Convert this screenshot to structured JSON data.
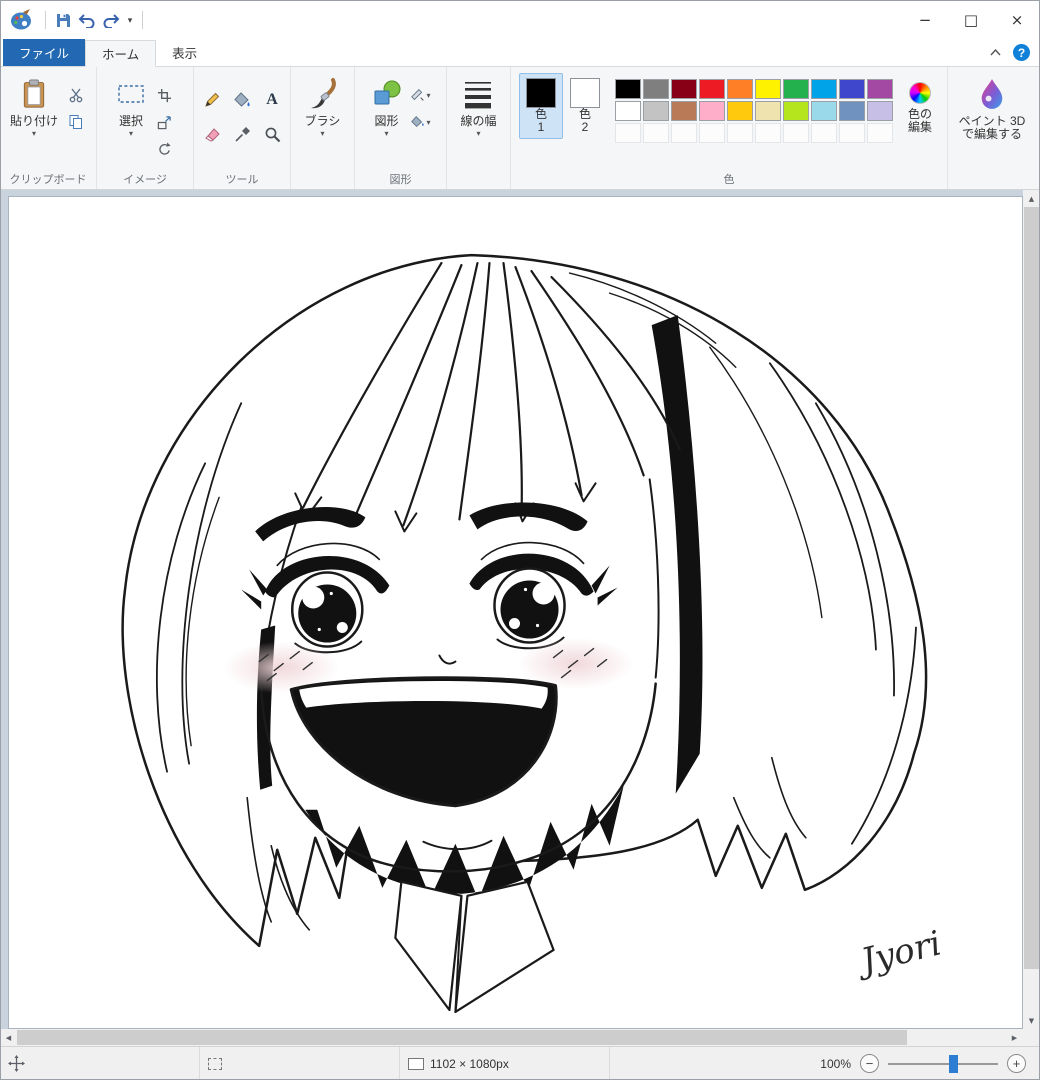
{
  "titlebar": {
    "window_controls": {
      "minimize": "−",
      "maximize": "□",
      "close": "×"
    }
  },
  "icons": {
    "dropdown": "▾",
    "help": "?",
    "text_tool": "A",
    "zoom_out": "−",
    "zoom_in": "+",
    "scroll_up": "▲",
    "scroll_down": "▼",
    "scroll_left": "◀",
    "scroll_right": "▶"
  },
  "tabs": {
    "file": "ファイル",
    "home": "ホーム",
    "view": "表示"
  },
  "ribbon": {
    "clipboard": {
      "group_label": "クリップボード",
      "paste": "貼り付け"
    },
    "image": {
      "group_label": "イメージ",
      "select": "選択"
    },
    "tools": {
      "group_label": "ツール"
    },
    "brush": {
      "label": "ブラシ"
    },
    "shapes": {
      "group_label": "図形",
      "button": "図形"
    },
    "size": {
      "label": "線の幅"
    },
    "colors": {
      "group_label": "色",
      "color1": {
        "line1": "色",
        "line2": "1",
        "value": "#000000"
      },
      "color2": {
        "line1": "色",
        "line2": "2",
        "value": "#ffffff"
      },
      "edit": {
        "line1": "色の",
        "line2": "編集"
      },
      "palette_row1": [
        "#000000",
        "#7f7f7f",
        "#880015",
        "#ed1c24",
        "#ff7f27",
        "#fff200",
        "#22b14c",
        "#00a2e8",
        "#3f48cc",
        "#a349a4"
      ],
      "palette_row2": [
        "#ffffff",
        "#c3c3c3",
        "#b97a57",
        "#ffaec9",
        "#ffc90e",
        "#efe4b0",
        "#b5e61d",
        "#99d9ea",
        "#7092be",
        "#c8bfe7"
      ],
      "palette_empty_count": 10
    },
    "paint3d": {
      "line1": "ペイント 3D",
      "line2": "で編集する"
    }
  },
  "canvas": {
    "signature": "Jyori"
  },
  "statusbar": {
    "canvas_size": "1102 × 1080px",
    "zoom": "100%"
  }
}
